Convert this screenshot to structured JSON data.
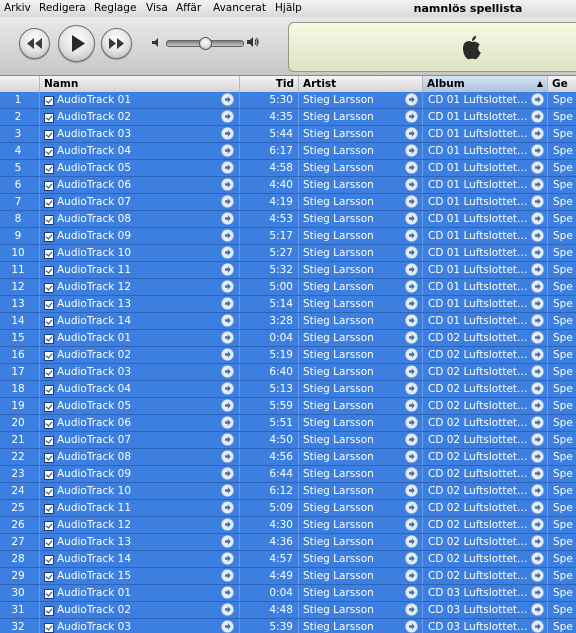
{
  "menubar": {
    "items": [
      "Arkiv",
      "Redigera",
      "Reglage",
      "Visa",
      "Affär",
      "Avancerat",
      "Hjälp"
    ],
    "window_title": "namnlös spellista"
  },
  "player": {
    "volume_level": 0.5
  },
  "columns": {
    "name": "Namn",
    "time": "Tid",
    "artist": "Artist",
    "album": "Album",
    "genre": "Ge",
    "sort_indicator": "▲"
  },
  "tracks": [
    {
      "num": "1",
      "name": "AudioTrack 01",
      "time": "5:30",
      "artist": "Stieg Larsson",
      "album": "CD 01 Luftslottet ...",
      "genre": "Spe"
    },
    {
      "num": "2",
      "name": "AudioTrack 02",
      "time": "4:35",
      "artist": "Stieg Larsson",
      "album": "CD 01 Luftslottet ...",
      "genre": "Spe"
    },
    {
      "num": "3",
      "name": "AudioTrack 03",
      "time": "5:44",
      "artist": "Stieg Larsson",
      "album": "CD 01 Luftslottet ...",
      "genre": "Spe"
    },
    {
      "num": "4",
      "name": "AudioTrack 04",
      "time": "6:17",
      "artist": "Stieg Larsson",
      "album": "CD 01 Luftslottet ...",
      "genre": "Spe"
    },
    {
      "num": "5",
      "name": "AudioTrack 05",
      "time": "4:58",
      "artist": "Stieg Larsson",
      "album": "CD 01 Luftslottet ...",
      "genre": "Spe"
    },
    {
      "num": "6",
      "name": "AudioTrack 06",
      "time": "4:40",
      "artist": "Stieg Larsson",
      "album": "CD 01 Luftslottet ...",
      "genre": "Spe"
    },
    {
      "num": "7",
      "name": "AudioTrack 07",
      "time": "4:19",
      "artist": "Stieg Larsson",
      "album": "CD 01 Luftslottet ...",
      "genre": "Spe"
    },
    {
      "num": "8",
      "name": "AudioTrack 08",
      "time": "4:53",
      "artist": "Stieg Larsson",
      "album": "CD 01 Luftslottet ...",
      "genre": "Spe"
    },
    {
      "num": "9",
      "name": "AudioTrack 09",
      "time": "5:17",
      "artist": "Stieg Larsson",
      "album": "CD 01 Luftslottet ...",
      "genre": "Spe"
    },
    {
      "num": "10",
      "name": "AudioTrack 10",
      "time": "5:27",
      "artist": "Stieg Larsson",
      "album": "CD 01 Luftslottet ...",
      "genre": "Spe"
    },
    {
      "num": "11",
      "name": "AudioTrack 11",
      "time": "5:32",
      "artist": "Stieg Larsson",
      "album": "CD 01 Luftslottet ...",
      "genre": "Spe"
    },
    {
      "num": "12",
      "name": "AudioTrack 12",
      "time": "5:00",
      "artist": "Stieg Larsson",
      "album": "CD 01 Luftslottet ...",
      "genre": "Spe"
    },
    {
      "num": "13",
      "name": "AudioTrack 13",
      "time": "5:14",
      "artist": "Stieg Larsson",
      "album": "CD 01 Luftslottet ...",
      "genre": "Spe"
    },
    {
      "num": "14",
      "name": "AudioTrack 14",
      "time": "3:28",
      "artist": "Stieg Larsson",
      "album": "CD 01 Luftslottet ...",
      "genre": "Spe"
    },
    {
      "num": "15",
      "name": "AudioTrack 01",
      "time": "0:04",
      "artist": "Stieg Larsson",
      "album": "CD 02 Luftslottet ...",
      "genre": "Spe"
    },
    {
      "num": "16",
      "name": "AudioTrack 02",
      "time": "5:19",
      "artist": "Stieg Larsson",
      "album": "CD 02 Luftslottet ...",
      "genre": "Spe"
    },
    {
      "num": "17",
      "name": "AudioTrack 03",
      "time": "6:40",
      "artist": "Stieg Larsson",
      "album": "CD 02 Luftslottet ...",
      "genre": "Spe"
    },
    {
      "num": "18",
      "name": "AudioTrack 04",
      "time": "5:13",
      "artist": "Stieg Larsson",
      "album": "CD 02 Luftslottet ...",
      "genre": "Spe"
    },
    {
      "num": "19",
      "name": "AudioTrack 05",
      "time": "5:59",
      "artist": "Stieg Larsson",
      "album": "CD 02 Luftslottet ...",
      "genre": "Spe"
    },
    {
      "num": "20",
      "name": "AudioTrack 06",
      "time": "5:51",
      "artist": "Stieg Larsson",
      "album": "CD 02 Luftslottet ...",
      "genre": "Spe"
    },
    {
      "num": "21",
      "name": "AudioTrack 07",
      "time": "4:50",
      "artist": "Stieg Larsson",
      "album": "CD 02 Luftslottet ...",
      "genre": "Spe"
    },
    {
      "num": "22",
      "name": "AudioTrack 08",
      "time": "4:56",
      "artist": "Stieg Larsson",
      "album": "CD 02 Luftslottet ...",
      "genre": "Spe"
    },
    {
      "num": "23",
      "name": "AudioTrack 09",
      "time": "6:44",
      "artist": "Stieg Larsson",
      "album": "CD 02 Luftslottet ...",
      "genre": "Spe"
    },
    {
      "num": "24",
      "name": "AudioTrack 10",
      "time": "6:12",
      "artist": "Stieg Larsson",
      "album": "CD 02 Luftslottet ...",
      "genre": "Spe"
    },
    {
      "num": "25",
      "name": "AudioTrack 11",
      "time": "5:09",
      "artist": "Stieg Larsson",
      "album": "CD 02 Luftslottet ...",
      "genre": "Spe"
    },
    {
      "num": "26",
      "name": "AudioTrack 12",
      "time": "4:30",
      "artist": "Stieg Larsson",
      "album": "CD 02 Luftslottet ...",
      "genre": "Spe"
    },
    {
      "num": "27",
      "name": "AudioTrack 13",
      "time": "4:36",
      "artist": "Stieg Larsson",
      "album": "CD 02 Luftslottet ...",
      "genre": "Spe"
    },
    {
      "num": "28",
      "name": "AudioTrack 14",
      "time": "4:57",
      "artist": "Stieg Larsson",
      "album": "CD 02 Luftslottet ...",
      "genre": "Spe"
    },
    {
      "num": "29",
      "name": "AudioTrack 15",
      "time": "4:49",
      "artist": "Stieg Larsson",
      "album": "CD 02 Luftslottet ...",
      "genre": "Spe"
    },
    {
      "num": "30",
      "name": "AudioTrack 01",
      "time": "0:04",
      "artist": "Stieg Larsson",
      "album": "CD 03 Luftslottet ...",
      "genre": "Spe"
    },
    {
      "num": "31",
      "name": "AudioTrack 02",
      "time": "4:48",
      "artist": "Stieg Larsson",
      "album": "CD 03 Luftslottet ...",
      "genre": "Spe"
    },
    {
      "num": "32",
      "name": "AudioTrack 03",
      "time": "5:39",
      "artist": "Stieg Larsson",
      "album": "CD 03 Luftslottet ...",
      "genre": "Spe"
    }
  ]
}
